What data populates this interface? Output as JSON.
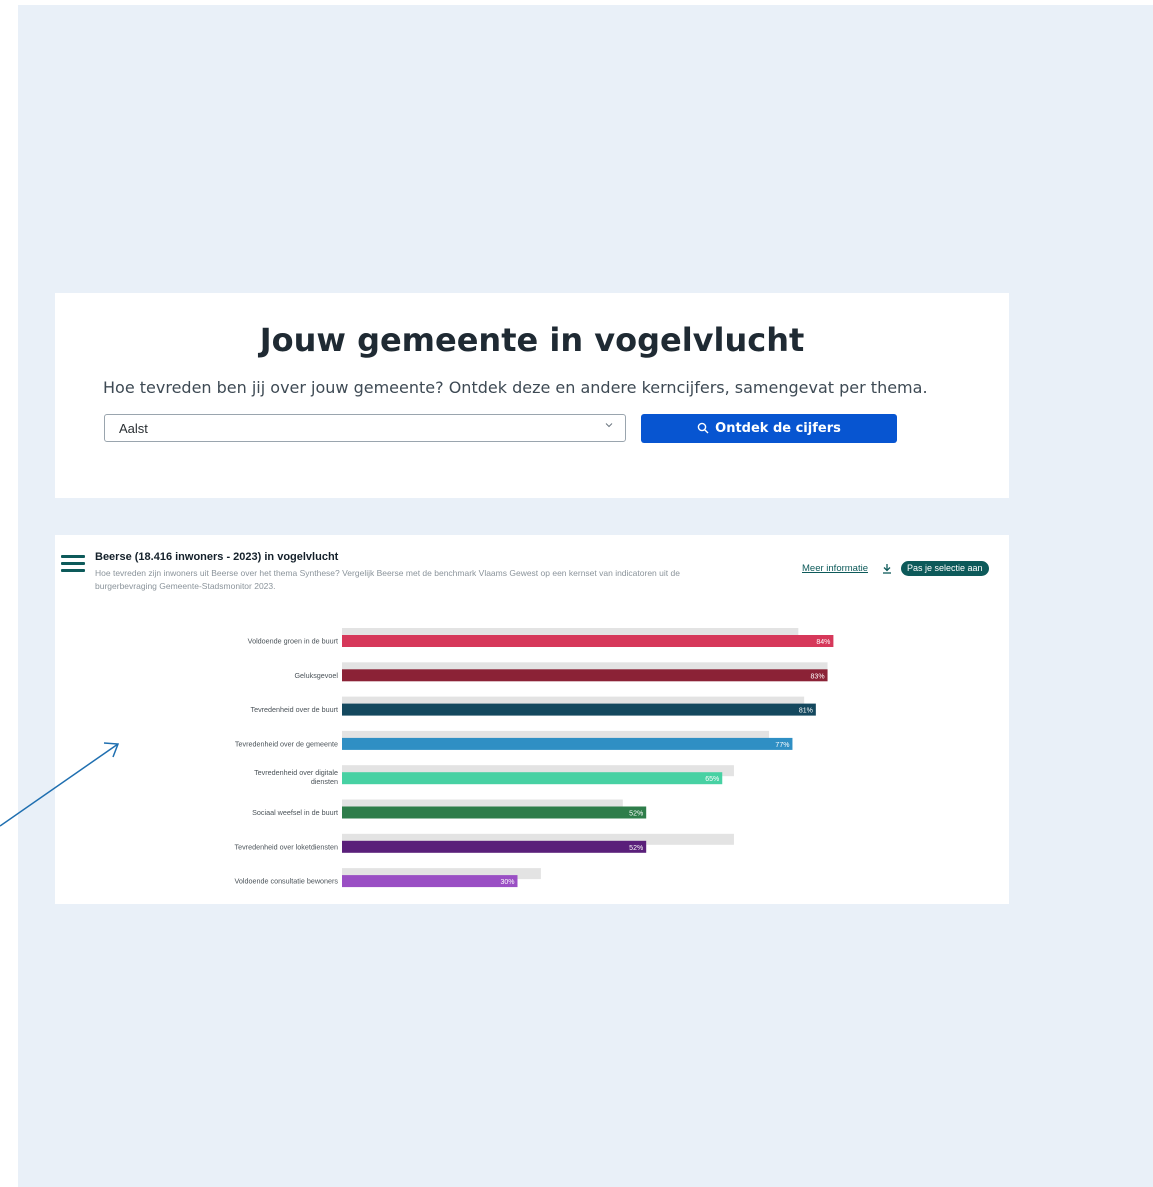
{
  "search": {
    "title": "Jouw gemeente in vogelvlucht",
    "subtitle": "Hoe tevreden ben jij over jouw gemeente? Ontdek deze en andere kerncijfers, samengevat per thema.",
    "selected_municipality": "Aalst",
    "button_label": "Ontdek de cijfers"
  },
  "chart_panel": {
    "title": "Beerse (18.416 inwoners - 2023) in vogelvlucht",
    "description": "Hoe tevreden zijn inwoners uit Beerse over het thema Synthese? Vergelijk Beerse met de benchmark Vlaams Gewest op een kernset van indicatoren uit de burgerbevraging Gemeente-Stadsmonitor 2023.",
    "more_info": "Meer informatie",
    "adjust_selection": "Pas je selectie aan"
  },
  "colors": {
    "accent_blue": "#0755d1",
    "teal": "#0d5a5a",
    "benchmark_gray": "#e3e3e3"
  },
  "chart_data": {
    "type": "bar",
    "orientation": "horizontal",
    "categories": [
      "Voldoende groen in de buurt",
      "Geluksgevoel",
      "Tevredenheid over de buurt",
      "Tevredenheid over de gemeente",
      "Tevredenheid over digitale diensten",
      "Sociaal weefsel in de buurt",
      "Tevredenheid over loketdiensten",
      "Voldoende consultatie bewoners"
    ],
    "series": [
      {
        "values": [
          84,
          83,
          81,
          77,
          65,
          52,
          52,
          30
        ],
        "value_labels": [
          "84%",
          "83%",
          "81%",
          "77%",
          "65%",
          "52%",
          "52%",
          "30%"
        ],
        "colors": [
          "#d6385a",
          "#8b2236",
          "#14485e",
          "#2f8fc4",
          "#47d1a3",
          "#2e7d4a",
          "#5a1f7a",
          "#9a4fc4"
        ]
      },
      {
        "values": [
          78,
          83,
          79,
          73,
          67,
          48,
          67,
          34
        ],
        "color": "#e3e3e3"
      }
    ],
    "xlim": [
      0,
      100
    ]
  }
}
